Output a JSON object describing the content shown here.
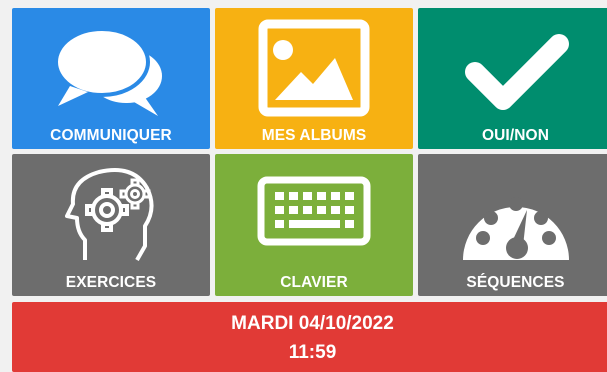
{
  "tiles": [
    {
      "label": "COMMUNIQUER",
      "icon": "speech-bubbles-icon",
      "color": "#2a8ae6"
    },
    {
      "label": "MES ALBUMS",
      "icon": "image-album-icon",
      "color": "#f7b112"
    },
    {
      "label": "OUI/NON",
      "icon": "checkmark-icon",
      "color": "#008d6e"
    },
    {
      "label": "EXERCICES",
      "icon": "head-gears-icon",
      "color": "#6d6d6d"
    },
    {
      "label": "CLAVIER",
      "icon": "keyboard-icon",
      "color": "#7caf3b"
    },
    {
      "label": "SÉQUENCES",
      "icon": "speedometer-icon",
      "color": "#6d6d6d"
    }
  ],
  "status": {
    "date": "MARDI 04/10/2022",
    "time": "11:59",
    "color": "#e13a36"
  }
}
